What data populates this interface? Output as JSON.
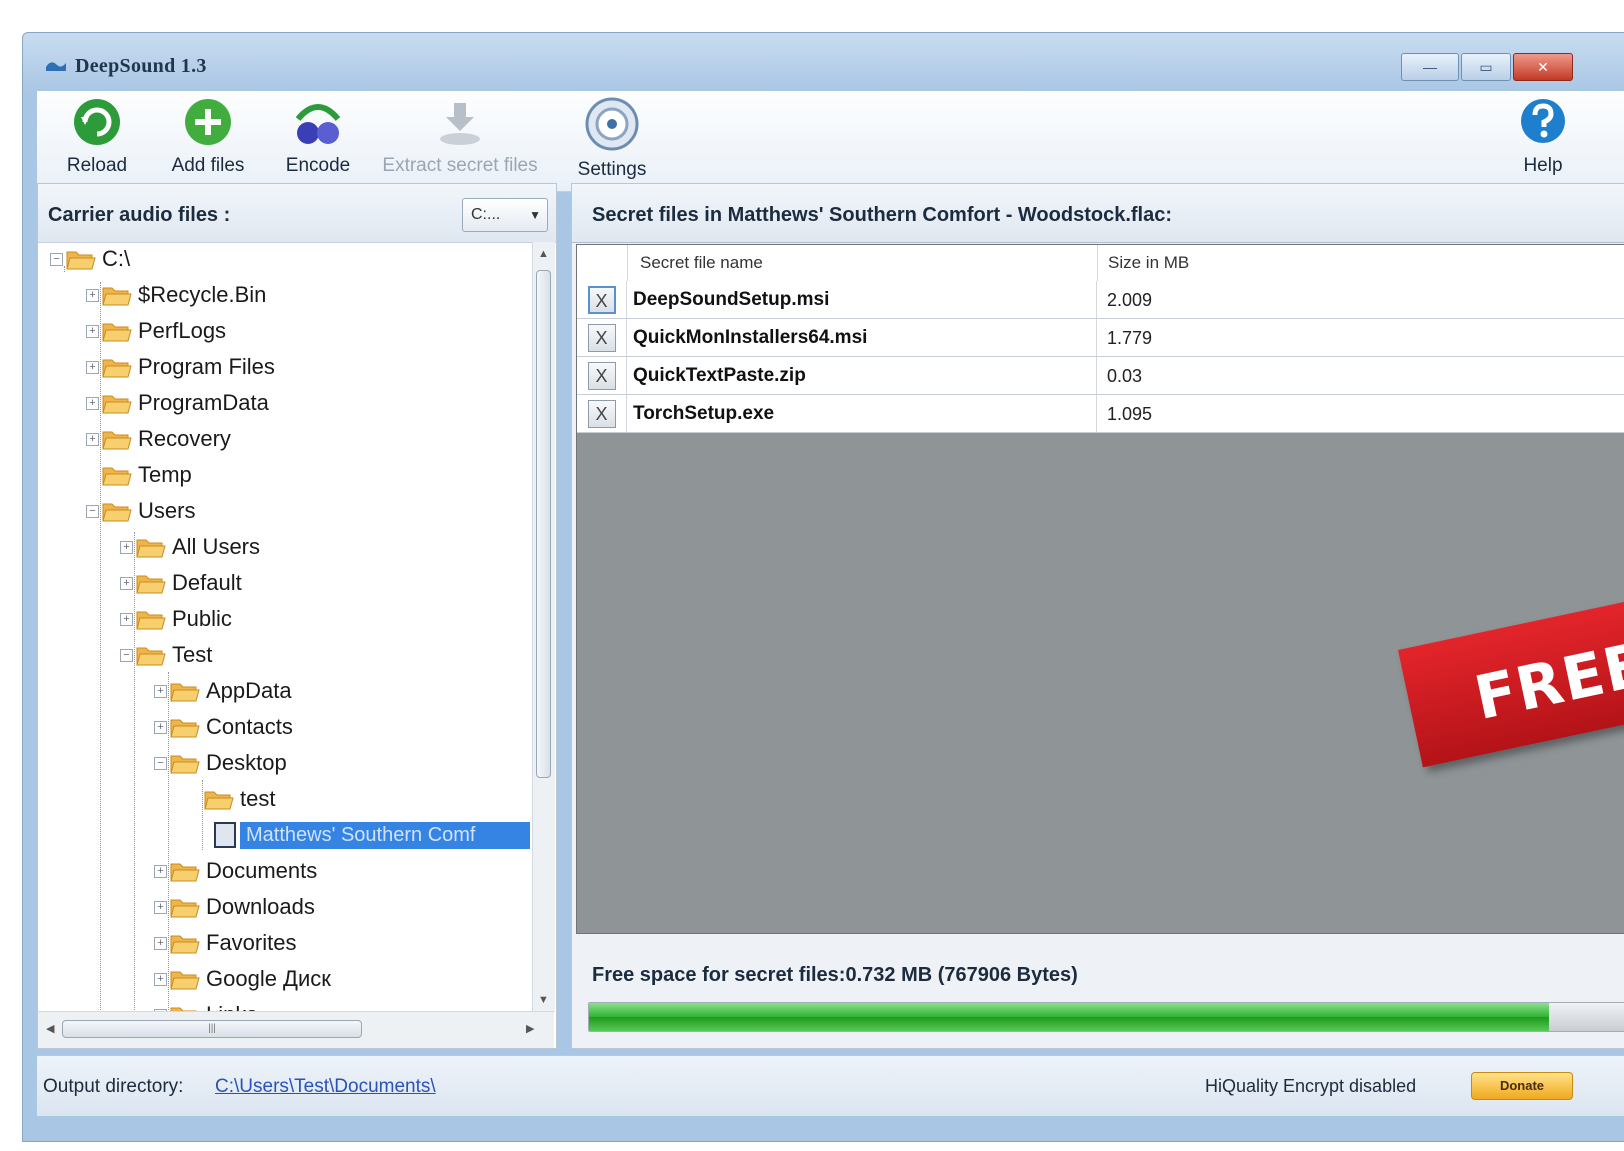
{
  "window": {
    "title": "DeepSound 1.3",
    "buttons": {
      "minimize": "—",
      "maximize": "▭",
      "close": "✕"
    }
  },
  "toolbar": {
    "reload": "Reload",
    "add_files": "Add files",
    "encode": "Encode",
    "extract": "Extract secret files",
    "settings": "Settings",
    "help": "Help"
  },
  "left": {
    "header": "Carrier audio files :",
    "drive": "C:...",
    "tree": {
      "root": "C:\\",
      "recycle": "$Recycle.Bin",
      "perflogs": "PerfLogs",
      "program_files": "Program Files",
      "program_data": "ProgramData",
      "recovery": "Recovery",
      "temp": "Temp",
      "users": "Users",
      "all_users": "All Users",
      "default": "Default",
      "public": "Public",
      "test": "Test",
      "appdata": "AppData",
      "contacts": "Contacts",
      "desktop": "Desktop",
      "test_sub": "test",
      "selected_file": "Matthews' Southern Comf",
      "documents": "Documents",
      "downloads": "Downloads",
      "favorites": "Favorites",
      "google": "Google Диск",
      "links": "Links"
    }
  },
  "right": {
    "header": "Secret files in Matthews' Southern Comfort - Woodstock.flac:",
    "columns": {
      "name": "Secret file name",
      "size": "Size in MB"
    },
    "rows": [
      {
        "name": "DeepSoundSetup.msi",
        "size": "2.009"
      },
      {
        "name": "QuickMonInstallers64.msi",
        "size": "1.779"
      },
      {
        "name": "QuickTextPaste.zip",
        "size": "0.03"
      },
      {
        "name": "TorchSetup.exe",
        "size": "1.095"
      }
    ],
    "delete_glyph": "X",
    "free_space": "Free space for secret files:0.732 MB (767906 Bytes)",
    "usage_fraction": 0.92
  },
  "banner": {
    "text": "FREE"
  },
  "status": {
    "output_label": "Output directory:",
    "output_path": "C:\\Users\\Test\\Documents\\",
    "flags": "HiQuality  Encrypt disabled",
    "donate": "Donate"
  },
  "colors": {
    "selection": "#3584e4",
    "progress": "#2fb32f",
    "banner": "#d21f25",
    "link": "#2a52b8"
  },
  "icons": {
    "reload": "reload-icon",
    "add_files": "add-files-icon",
    "encode": "encode-icon",
    "extract": "extract-icon",
    "settings": "settings-icon",
    "help": "help-icon",
    "folder": "folder-icon",
    "audio_file": "audio-file-icon"
  }
}
